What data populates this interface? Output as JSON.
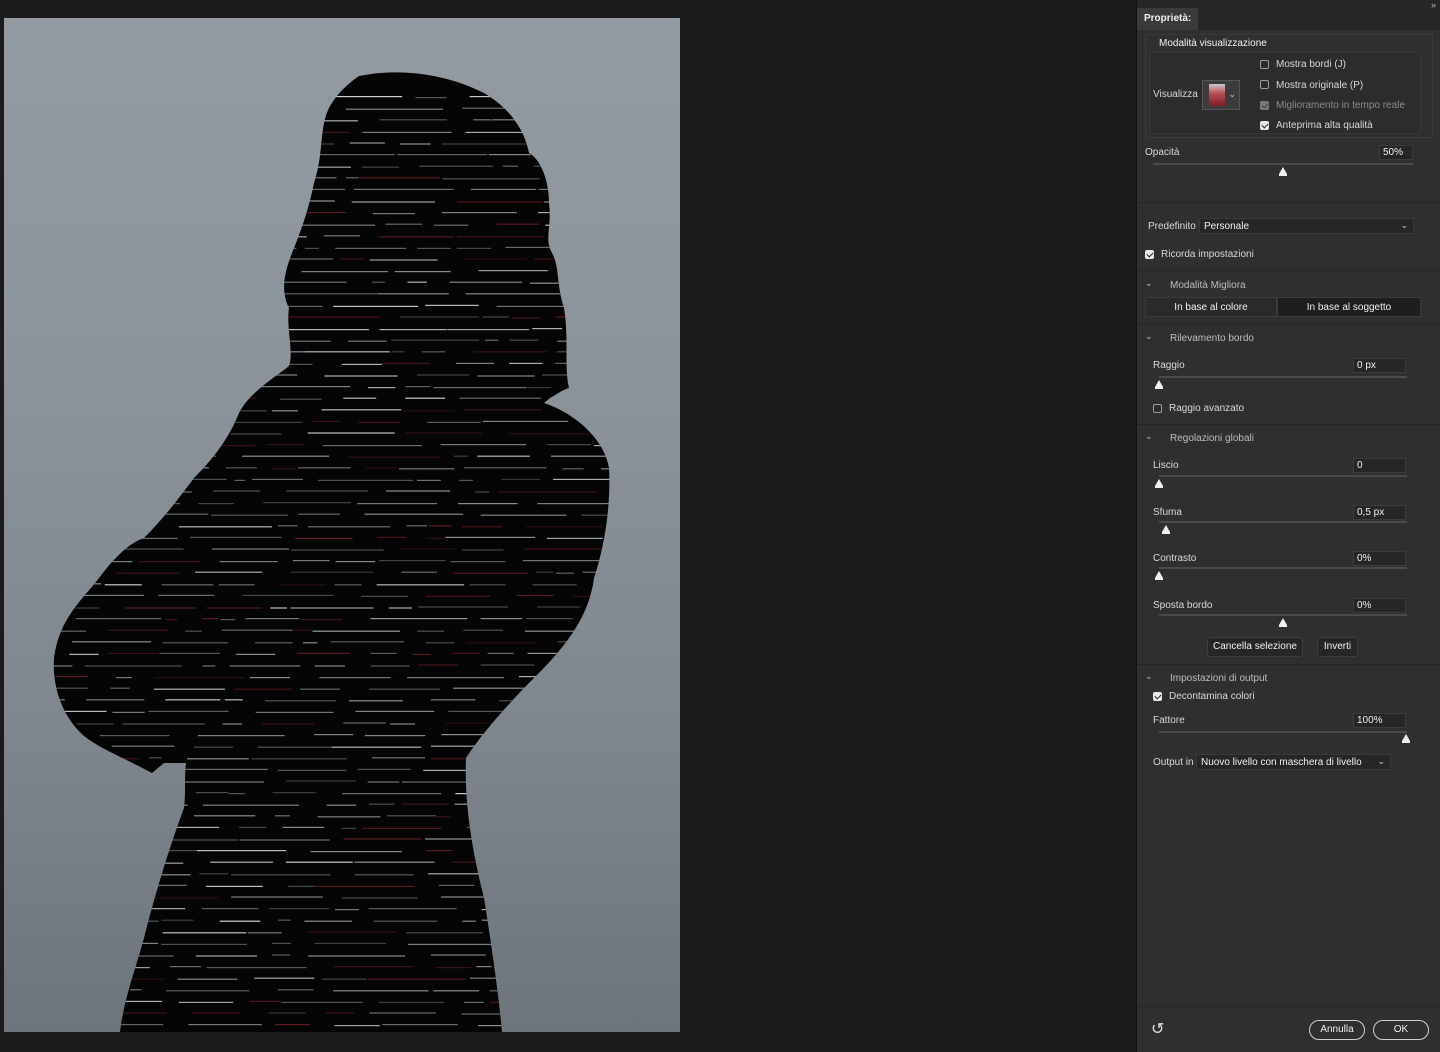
{
  "panel": {
    "tab_label": "Proprietà",
    "collapse_glyph": "»",
    "view_mode": {
      "section_title": "Modalità visualizzazione",
      "view_label": "Visualizza",
      "options": [
        {
          "label": "Mostra bordi (J)",
          "checked": false,
          "disabled": false
        },
        {
          "label": "Mostra originale (P)",
          "checked": false,
          "disabled": false
        },
        {
          "label": "Miglioramento in tempo reale",
          "checked": true,
          "disabled": true
        },
        {
          "label": "Anteprima alta qualità",
          "checked": true,
          "disabled": false
        }
      ]
    },
    "opacity": {
      "label": "Opacità",
      "value": "50%",
      "level": 0.5
    },
    "preset": {
      "label": "Predefinito",
      "value": "Personale"
    },
    "remember": {
      "label": "Ricorda impostazioni",
      "checked": true
    },
    "refine_mode": {
      "title": "Modalità Migliora",
      "options": [
        "In base al colore",
        "In base al soggetto"
      ],
      "selected_index": 1
    },
    "edge_detection": {
      "title": "Rilevamento bordo",
      "radius": {
        "label": "Raggio",
        "value": "0 px",
        "level": 0
      },
      "smart_radius": {
        "label": "Raggio avanzato",
        "checked": false
      }
    },
    "global": {
      "title": "Regolazioni globali",
      "smooth": {
        "label": "Liscio",
        "value": "0",
        "level": 0
      },
      "feather": {
        "label": "Sfuma",
        "value": "0,5 px",
        "level": 0.03
      },
      "contrast": {
        "label": "Contrasto",
        "value": "0%",
        "level": 0
      },
      "shift_edge": {
        "label": "Sposta bordo",
        "value": "0%",
        "level": 0.5
      },
      "clear_button": "Cancella selezione",
      "invert_button": "Inverti"
    },
    "output": {
      "title": "Impostazioni di output",
      "decontaminate": {
        "label": "Decontamina colori",
        "checked": true
      },
      "amount": {
        "label": "Fattore",
        "value": "100%",
        "level": 1
      },
      "output_to_label": "Output in",
      "output_to_value": "Nuovo livello con maschera di livello"
    },
    "footer": {
      "reset_glyph": "↺",
      "cancel": "Annulla",
      "ok": "OK"
    },
    "chevron": "⌄",
    "dropdown_arrow": "⌄"
  },
  "colors": {
    "panel_bg": "#2f2f2f",
    "canvas_bg": "#1b1b1b",
    "photo_bg": "#8e959d",
    "silhouette": "#050505"
  }
}
